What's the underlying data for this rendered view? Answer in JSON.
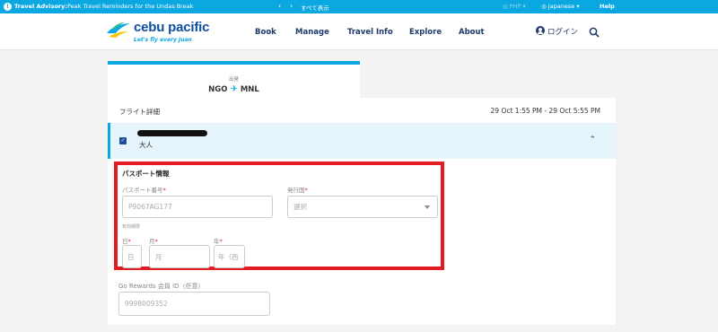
{
  "advisory": {
    "label": "Travel Advisory:",
    "text": "Peak Travel Reminders for the Undas Break",
    "prev_icon": "chevron-left-icon",
    "next_icon": "chevron-right-icon",
    "show_all": "すべて表示",
    "currency": "PHP",
    "language": "Japanese",
    "help": "Help",
    "bg_color": "#0aa7e0"
  },
  "header": {
    "logo_name": "cebu pacific",
    "logo_tagline": "Let's fly every Juan",
    "nav": [
      "Book",
      "Manage",
      "Travel Info",
      "Explore",
      "About"
    ],
    "login": "ログイン",
    "brand_color": "#0d4ea1"
  },
  "route": {
    "departure_label": "出発",
    "origin": "NGO",
    "destination": "MNL",
    "plane_icon": "airplane-icon"
  },
  "flight_details": {
    "title": "フライト詳細",
    "time_range": "29 Oct 1:55 PM - 29 Oct 5:55 PM"
  },
  "passenger": {
    "type": "大人",
    "checked": true
  },
  "passport": {
    "title": "パスポート情報",
    "number_label": "パスポート番号",
    "number_placeholder": "P9067AG177",
    "country_label": "発行国",
    "country_placeholder": "選択",
    "expiry_label": "有効期限",
    "day_label": "日",
    "day_placeholder": "日",
    "month_label": "月",
    "month_placeholder": "月",
    "year_label": "年",
    "year_placeholder": "年（西",
    "required_mark": "*",
    "highlight_color": "#e31b23"
  },
  "go_rewards": {
    "label": "Go Rewards 会員 ID（任意）",
    "placeholder": "9998009352"
  }
}
